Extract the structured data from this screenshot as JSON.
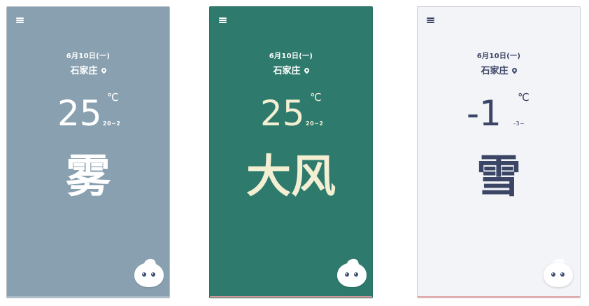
{
  "cards": [
    {
      "date": "6月10日(一)",
      "city": "石家庄",
      "temp": "25",
      "unit": "℃",
      "range": "20~2",
      "weather": "雾",
      "colors": {
        "bg": "#89a0b0",
        "text": "#ffffff",
        "under": "#a9bcc8"
      }
    },
    {
      "date": "6月10日(一)",
      "city": "石家庄",
      "temp": "25",
      "unit": "℃",
      "range": "20~2",
      "weather": "大风",
      "colors": {
        "bg": "#2e7a6d",
        "text": "#f3efd2",
        "under": "#d89c9c"
      }
    },
    {
      "date": "6月10日(一)",
      "city": "石家庄",
      "temp": "-1",
      "unit": "℃",
      "range": "-3~",
      "weather": "雪",
      "colors": {
        "bg": "#f2f4f7",
        "text": "#3b4565",
        "under": "#e3a5a5"
      }
    }
  ]
}
